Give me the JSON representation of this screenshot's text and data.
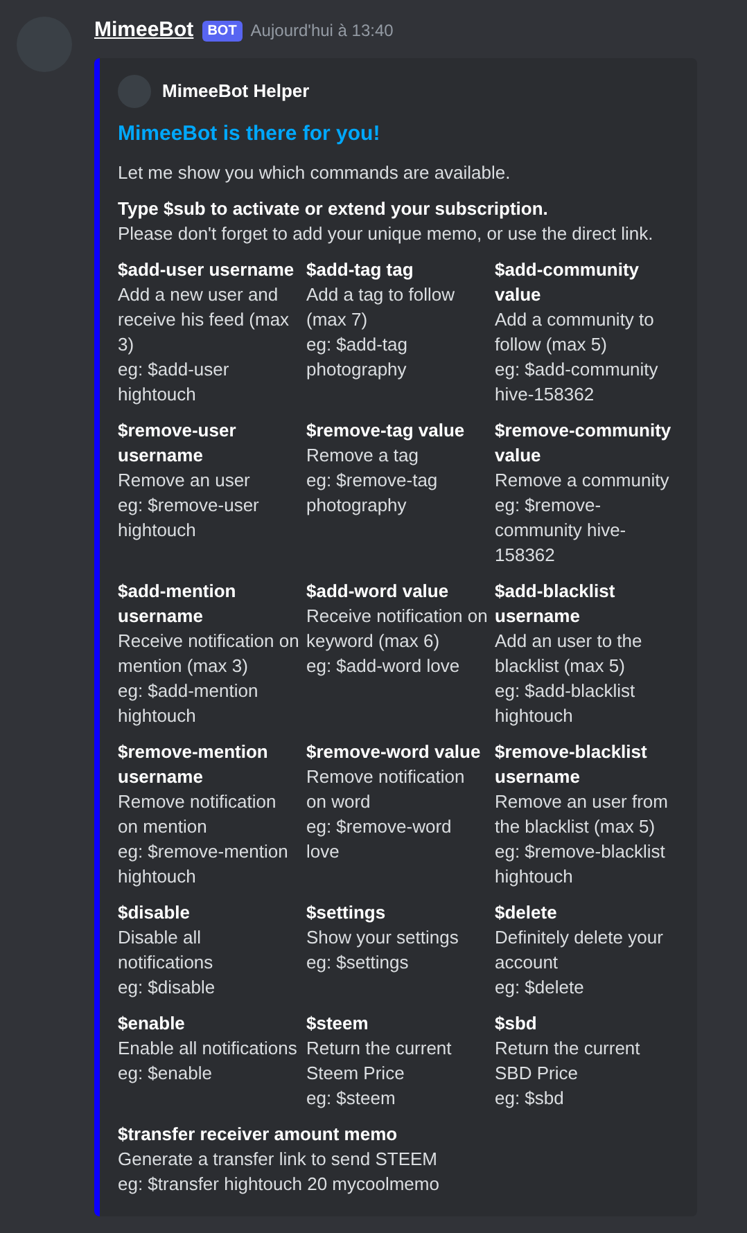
{
  "message": {
    "author": "MimeeBot",
    "badge": "BOT",
    "timestamp": "Aujourd'hui à 13:40"
  },
  "embed": {
    "author": "MimeeBot Helper",
    "title": "MimeeBot is there for you!",
    "description": "Let me show you which commands are available.",
    "subscription": {
      "heading": "Type $sub to activate or extend your subscription.",
      "text": "Please don't forget to add your unique memo, or use the direct link."
    },
    "field_rows": [
      [
        {
          "name": "$add-user username",
          "lines": [
            "Add a new user and receive his feed (max 3)",
            "eg: $add-user hightouch"
          ]
        },
        {
          "name": "$add-tag tag",
          "lines": [
            "Add a tag to follow (max 7)",
            "eg: $add-tag photography"
          ]
        },
        {
          "name": "$add-community value",
          "lines": [
            "Add a community to follow (max 5)",
            "eg: $add-community hive-158362"
          ]
        }
      ],
      [
        {
          "name": "$remove-user username",
          "lines": [
            "Remove an user",
            "eg: $remove-user hightouch"
          ]
        },
        {
          "name": "$remove-tag value",
          "lines": [
            "Remove a tag",
            "eg: $remove-tag photography"
          ]
        },
        {
          "name": "$remove-community value",
          "lines": [
            "Remove a community",
            "eg: $remove-community hive-158362"
          ]
        }
      ],
      [
        {
          "name": "$add-mention username",
          "lines": [
            "Receive notification on mention (max 3)",
            "eg: $add-mention hightouch"
          ]
        },
        {
          "name": "$add-word value",
          "lines": [
            "Receive notification on keyword (max 6)",
            "eg: $add-word love"
          ]
        },
        {
          "name": "$add-blacklist username",
          "lines": [
            "Add an user to the blacklist (max 5)",
            "eg: $add-blacklist hightouch"
          ]
        }
      ],
      [
        {
          "name": "$remove-mention username",
          "lines": [
            "Remove notification on mention",
            "eg: $remove-mention hightouch"
          ]
        },
        {
          "name": "$remove-word value",
          "lines": [
            "Remove notification on word",
            "eg: $remove-word love"
          ]
        },
        {
          "name": "$remove-blacklist username",
          "lines": [
            "Remove an user from the blacklist (max 5)",
            "eg: $remove-blacklist hightouch"
          ]
        }
      ],
      [
        {
          "name": "$disable",
          "lines": [
            "Disable all notifications",
            "eg: $disable"
          ]
        },
        {
          "name": "$settings",
          "lines": [
            "Show your settings",
            "eg: $settings"
          ]
        },
        {
          "name": "$delete",
          "lines": [
            "Definitely delete your account",
            "eg: $delete"
          ]
        }
      ],
      [
        {
          "name": "$enable",
          "lines": [
            "Enable all notifications",
            "eg: $enable"
          ]
        },
        {
          "name": "$steem",
          "lines": [
            "Return the current Steem Price",
            "eg: $steem"
          ]
        },
        {
          "name": "$sbd",
          "lines": [
            "Return the current SBD Price",
            "eg: $sbd"
          ]
        }
      ],
      [
        {
          "name": "$transfer receiver amount memo",
          "lines": [
            "Generate a transfer link to send STEEM",
            "eg: $transfer hightouch 20 mycoolmemo"
          ]
        }
      ]
    ]
  }
}
